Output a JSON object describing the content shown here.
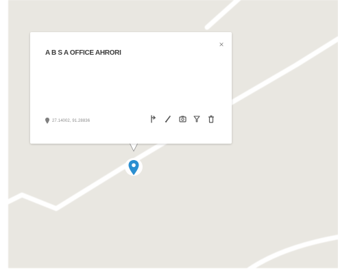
{
  "map": {
    "background_color": "#e9e7e1",
    "road_color": "#ffffff",
    "marker_color": "#2b8fd0"
  },
  "popup": {
    "title": "A B S A OFFICE AHRORI",
    "coordinates": "27.14002, 91.28836",
    "close_symbol": "×",
    "actions": [
      {
        "name": "directions-icon"
      },
      {
        "name": "edit-pencil-icon"
      },
      {
        "name": "camera-icon"
      },
      {
        "name": "filter-icon"
      },
      {
        "name": "delete-trash-icon"
      }
    ]
  }
}
